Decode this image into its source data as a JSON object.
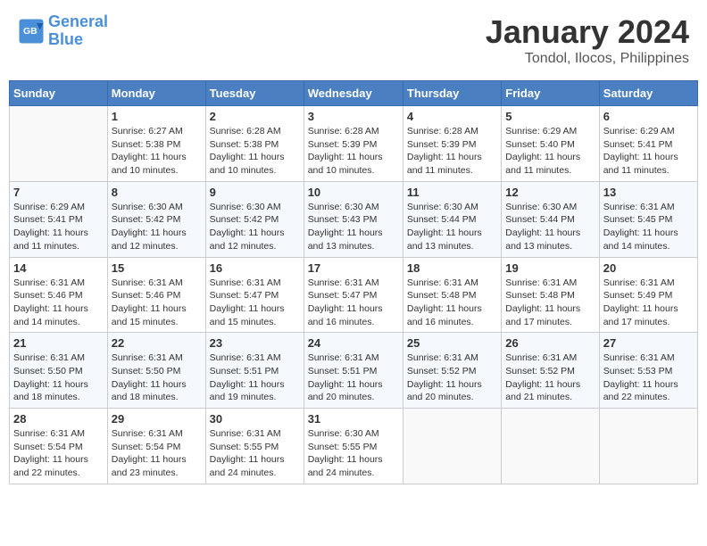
{
  "header": {
    "logo_line1": "General",
    "logo_line2": "Blue",
    "main_title": "January 2024",
    "subtitle": "Tondol, Ilocos, Philippines"
  },
  "calendar": {
    "headers": [
      "Sunday",
      "Monday",
      "Tuesday",
      "Wednesday",
      "Thursday",
      "Friday",
      "Saturday"
    ],
    "weeks": [
      [
        {
          "day": "",
          "sunrise": "",
          "sunset": "",
          "daylight": ""
        },
        {
          "day": "1",
          "sunrise": "6:27 AM",
          "sunset": "5:38 PM",
          "daylight": "11 hours and 10 minutes."
        },
        {
          "day": "2",
          "sunrise": "6:28 AM",
          "sunset": "5:38 PM",
          "daylight": "11 hours and 10 minutes."
        },
        {
          "day": "3",
          "sunrise": "6:28 AM",
          "sunset": "5:39 PM",
          "daylight": "11 hours and 10 minutes."
        },
        {
          "day": "4",
          "sunrise": "6:28 AM",
          "sunset": "5:39 PM",
          "daylight": "11 hours and 11 minutes."
        },
        {
          "day": "5",
          "sunrise": "6:29 AM",
          "sunset": "5:40 PM",
          "daylight": "11 hours and 11 minutes."
        },
        {
          "day": "6",
          "sunrise": "6:29 AM",
          "sunset": "5:41 PM",
          "daylight": "11 hours and 11 minutes."
        }
      ],
      [
        {
          "day": "7",
          "sunrise": "6:29 AM",
          "sunset": "5:41 PM",
          "daylight": "11 hours and 11 minutes."
        },
        {
          "day": "8",
          "sunrise": "6:30 AM",
          "sunset": "5:42 PM",
          "daylight": "11 hours and 12 minutes."
        },
        {
          "day": "9",
          "sunrise": "6:30 AM",
          "sunset": "5:42 PM",
          "daylight": "11 hours and 12 minutes."
        },
        {
          "day": "10",
          "sunrise": "6:30 AM",
          "sunset": "5:43 PM",
          "daylight": "11 hours and 13 minutes."
        },
        {
          "day": "11",
          "sunrise": "6:30 AM",
          "sunset": "5:44 PM",
          "daylight": "11 hours and 13 minutes."
        },
        {
          "day": "12",
          "sunrise": "6:30 AM",
          "sunset": "5:44 PM",
          "daylight": "11 hours and 13 minutes."
        },
        {
          "day": "13",
          "sunrise": "6:31 AM",
          "sunset": "5:45 PM",
          "daylight": "11 hours and 14 minutes."
        }
      ],
      [
        {
          "day": "14",
          "sunrise": "6:31 AM",
          "sunset": "5:46 PM",
          "daylight": "11 hours and 14 minutes."
        },
        {
          "day": "15",
          "sunrise": "6:31 AM",
          "sunset": "5:46 PM",
          "daylight": "11 hours and 15 minutes."
        },
        {
          "day": "16",
          "sunrise": "6:31 AM",
          "sunset": "5:47 PM",
          "daylight": "11 hours and 15 minutes."
        },
        {
          "day": "17",
          "sunrise": "6:31 AM",
          "sunset": "5:47 PM",
          "daylight": "11 hours and 16 minutes."
        },
        {
          "day": "18",
          "sunrise": "6:31 AM",
          "sunset": "5:48 PM",
          "daylight": "11 hours and 16 minutes."
        },
        {
          "day": "19",
          "sunrise": "6:31 AM",
          "sunset": "5:48 PM",
          "daylight": "11 hours and 17 minutes."
        },
        {
          "day": "20",
          "sunrise": "6:31 AM",
          "sunset": "5:49 PM",
          "daylight": "11 hours and 17 minutes."
        }
      ],
      [
        {
          "day": "21",
          "sunrise": "6:31 AM",
          "sunset": "5:50 PM",
          "daylight": "11 hours and 18 minutes."
        },
        {
          "day": "22",
          "sunrise": "6:31 AM",
          "sunset": "5:50 PM",
          "daylight": "11 hours and 18 minutes."
        },
        {
          "day": "23",
          "sunrise": "6:31 AM",
          "sunset": "5:51 PM",
          "daylight": "11 hours and 19 minutes."
        },
        {
          "day": "24",
          "sunrise": "6:31 AM",
          "sunset": "5:51 PM",
          "daylight": "11 hours and 20 minutes."
        },
        {
          "day": "25",
          "sunrise": "6:31 AM",
          "sunset": "5:52 PM",
          "daylight": "11 hours and 20 minutes."
        },
        {
          "day": "26",
          "sunrise": "6:31 AM",
          "sunset": "5:52 PM",
          "daylight": "11 hours and 21 minutes."
        },
        {
          "day": "27",
          "sunrise": "6:31 AM",
          "sunset": "5:53 PM",
          "daylight": "11 hours and 22 minutes."
        }
      ],
      [
        {
          "day": "28",
          "sunrise": "6:31 AM",
          "sunset": "5:54 PM",
          "daylight": "11 hours and 22 minutes."
        },
        {
          "day": "29",
          "sunrise": "6:31 AM",
          "sunset": "5:54 PM",
          "daylight": "11 hours and 23 minutes."
        },
        {
          "day": "30",
          "sunrise": "6:31 AM",
          "sunset": "5:55 PM",
          "daylight": "11 hours and 24 minutes."
        },
        {
          "day": "31",
          "sunrise": "6:30 AM",
          "sunset": "5:55 PM",
          "daylight": "11 hours and 24 minutes."
        },
        {
          "day": "",
          "sunrise": "",
          "sunset": "",
          "daylight": ""
        },
        {
          "day": "",
          "sunrise": "",
          "sunset": "",
          "daylight": ""
        },
        {
          "day": "",
          "sunrise": "",
          "sunset": "",
          "daylight": ""
        }
      ]
    ]
  }
}
